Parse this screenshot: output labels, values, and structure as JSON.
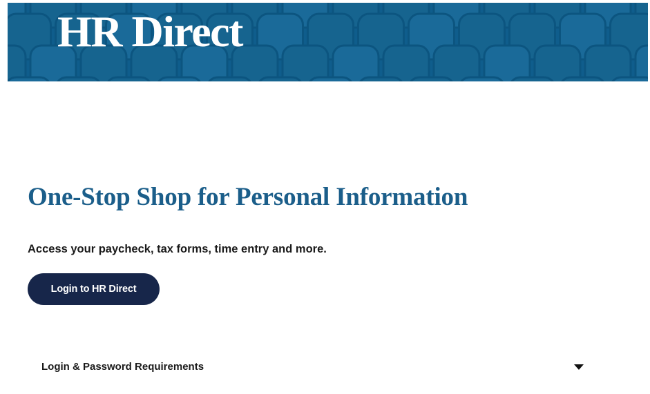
{
  "banner": {
    "title": "HR Direct",
    "background_color": "#0f5d8c"
  },
  "main": {
    "heading": "One-Stop Shop for Personal Information",
    "lead": "Access your paycheck, tax forms, time entry and more.",
    "login_button_label": "Login to HR Direct"
  },
  "accordion": {
    "label": "Login & Password Requirements",
    "icon": "caret-down-icon",
    "expanded": false
  },
  "colors": {
    "heading": "#1b5e8a",
    "button": "#17264a",
    "text": "#1a1a1a"
  }
}
